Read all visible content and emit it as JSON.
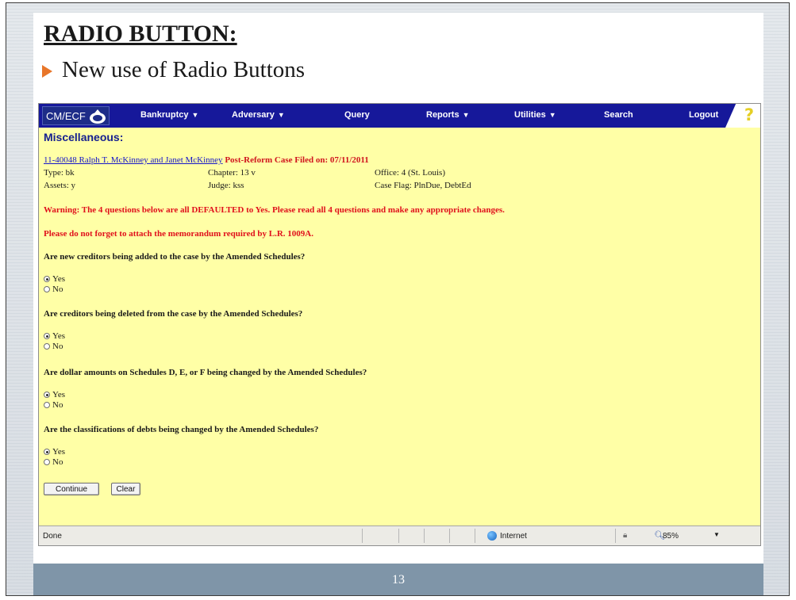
{
  "slide": {
    "title": "RADIO BUTTON:",
    "bullet": "New use of Radio Buttons",
    "page_number": "13"
  },
  "app": {
    "logo": "CM/ECF",
    "menu": [
      {
        "label": "Bankruptcy",
        "has_dropdown": true
      },
      {
        "label": "Adversary",
        "has_dropdown": true
      },
      {
        "label": "Query",
        "has_dropdown": false
      },
      {
        "label": "Reports",
        "has_dropdown": true
      },
      {
        "label": "Utilities",
        "has_dropdown": true
      },
      {
        "label": "Search",
        "has_dropdown": false
      },
      {
        "label": "Logout",
        "has_dropdown": false
      }
    ],
    "caret": "▼",
    "help_icon": "?"
  },
  "page": {
    "heading": "Miscellaneous:",
    "case_link": "11-40048 Ralph T. McKinney and Janet McKinney",
    "case_tag": "Post-Reform Case Filed on: 07/11/2011",
    "type": "Type: bk",
    "chapter": "Chapter: 13 v",
    "office": "Office: 4 (St. Louis)",
    "assets": "Assets: y",
    "judge": "Judge: kss",
    "case_flag": "Case Flag: PlnDue, DebtEd",
    "warning_1": "Warning: The 4 questions below are all DEFAULTED to Yes. Please read all 4 questions and make any appropriate changes.",
    "warning_2": "Please do not forget to attach the memorandum required by L.R. 1009A.",
    "questions": [
      {
        "text": "Are new creditors being added to the case by the Amended Schedules?",
        "yes": "Yes",
        "no": "No",
        "selected": "Yes"
      },
      {
        "text": "Are creditors being deleted from the case by the Amended Schedules?",
        "yes": "Yes",
        "no": "No",
        "selected": "Yes"
      },
      {
        "text": "Are dollar amounts on Schedules D, E, or F being changed by the Amended Schedules?",
        "yes": "Yes",
        "no": "No",
        "selected": "Yes"
      },
      {
        "text": "Are the classifications of debts being changed by the Amended Schedules?",
        "yes": "Yes",
        "no": "No",
        "selected": "Yes"
      }
    ],
    "continue_label": "Continue",
    "clear_label": "Clear"
  },
  "statusbar": {
    "status": "Done",
    "zone": "Internet",
    "zoom": "85%",
    "lock_icon": "🔒︎",
    "zoom_icon": "🔍︎",
    "caret": "▼"
  },
  "colors": {
    "menubar": "#16189a",
    "page_background": "#ffffa6",
    "warning": "#e0101c",
    "link": "#1515c9",
    "footer": "#7f95a8",
    "bullet": "#e8762a"
  }
}
